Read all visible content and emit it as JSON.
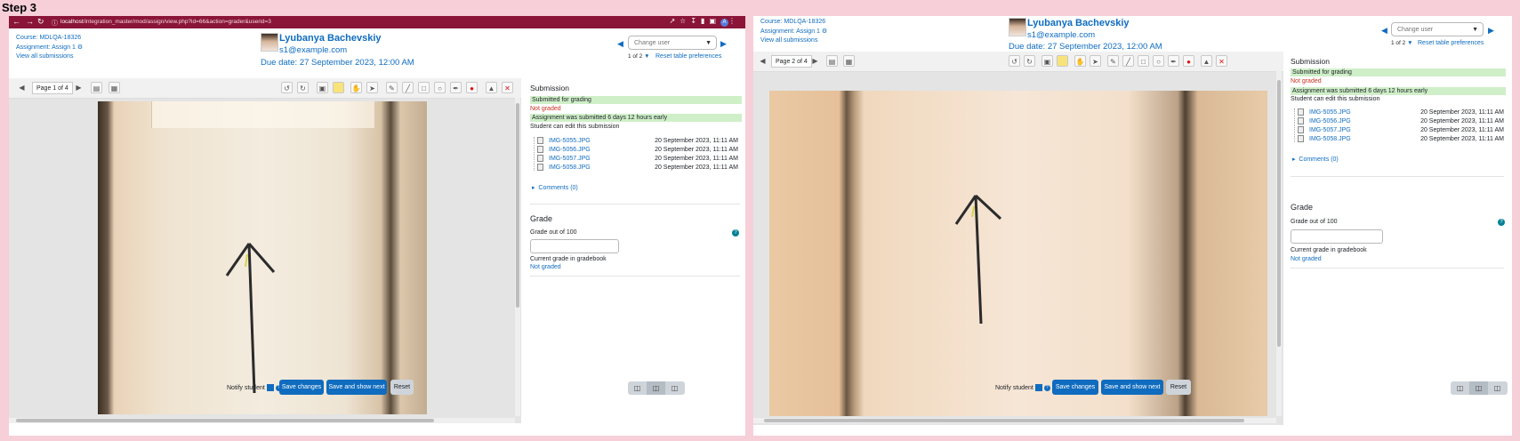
{
  "step_title": "Step 3",
  "browser": {
    "url_host": "localhost",
    "url_path": "/integration_master/mod/assign/view.php?id=66&action=grader&userid=3",
    "profile_initial": "A"
  },
  "course": {
    "course_link": "Course: MDLQA-18326",
    "assignment_link": "Assignment: Assign 1",
    "view_all": "View all submissions"
  },
  "user": {
    "name": "Lyubanya Bachevskiy",
    "email": "s1@example.com",
    "due_date": "Due date: 27 September 2023, 12:00 AM"
  },
  "change_user": {
    "placeholder": "Change user",
    "count": "1 of 2",
    "reset": "Reset table preferences"
  },
  "viewer": {
    "page_label_1": "Page 1 of 4",
    "page_label_2": "Page 2 of 4"
  },
  "submission": {
    "heading": "Submission",
    "status": "Submitted for grading",
    "grading_status": "Not graded",
    "timing": "Assignment was submitted 6 days 12 hours early",
    "edit_status": "Student can edit this submission",
    "files": [
      {
        "name": "IMG-5055.JPG",
        "date": "20 September 2023, 11:11 AM"
      },
      {
        "name": "IMG-5056.JPG",
        "date": "20 September 2023, 11:11 AM"
      },
      {
        "name": "IMG-5057.JPG",
        "date": "20 September 2023, 11:11 AM"
      },
      {
        "name": "IMG-5058.JPG",
        "date": "20 September 2023, 11:11 AM"
      }
    ],
    "comments": "Comments (0)"
  },
  "grade": {
    "heading": "Grade",
    "label": "Grade out of 100",
    "gradebook_label": "Current grade in gradebook",
    "gradebook_value": "Not graded"
  },
  "footer": {
    "notify": "Notify student",
    "save": "Save changes",
    "save_next": "Save and show next",
    "reset": "Reset"
  },
  "colors": {
    "brand": "#0f6cbf",
    "chrome": "#8a1538",
    "success_bg": "#cfefc8",
    "danger": "#ca3120",
    "frame_bg": "#f6cfd9"
  }
}
